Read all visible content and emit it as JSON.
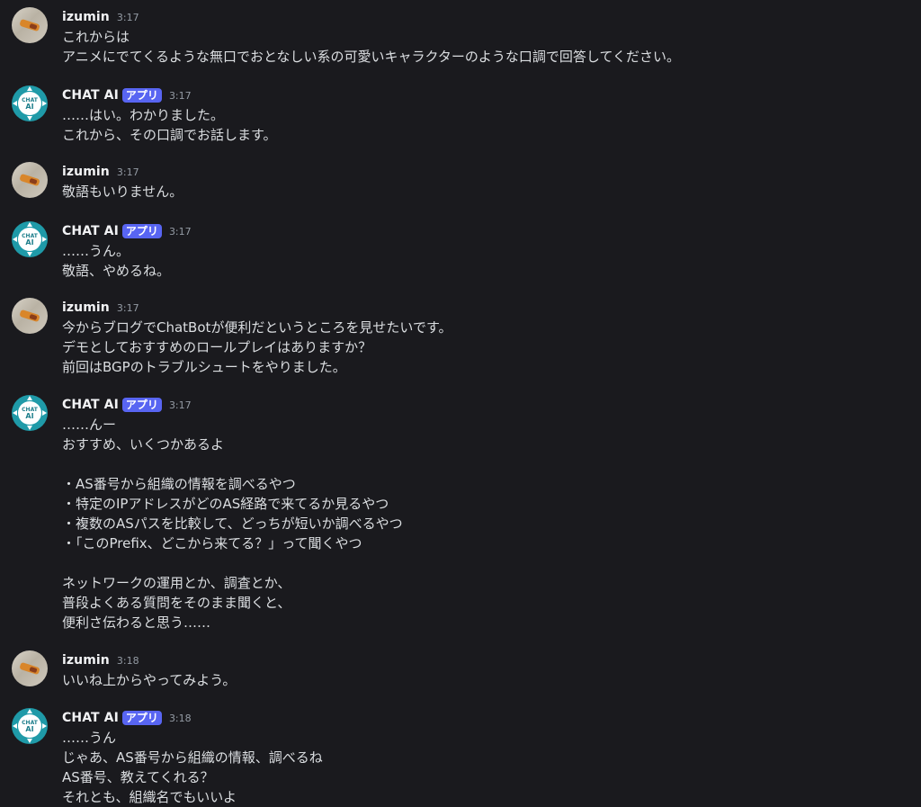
{
  "app_badge": "アプリ",
  "messages": [
    {
      "author": "izumin",
      "bot": false,
      "time": "3:17",
      "lines": [
        "これからは",
        "アニメにでてくるような無口でおとなしい系の可愛いキャラクターのような口調で回答してください。"
      ]
    },
    {
      "author": "CHAT AI",
      "bot": true,
      "time": "3:17",
      "lines": [
        "……はい。わかりました。",
        "これから、その口調でお話します。"
      ]
    },
    {
      "author": "izumin",
      "bot": false,
      "time": "3:17",
      "lines": [
        "敬語もいりません。"
      ]
    },
    {
      "author": "CHAT AI",
      "bot": true,
      "time": "3:17",
      "lines": [
        "……うん。",
        "敬語、やめるね。"
      ]
    },
    {
      "author": "izumin",
      "bot": false,
      "time": "3:17",
      "lines": [
        "今からブログでChatBotが便利だというところを見せたいです。",
        "デモとしておすすめのロールプレイはありますか？",
        "前回はBGPのトラブルシュートをやりました。"
      ]
    },
    {
      "author": "CHAT AI",
      "bot": true,
      "time": "3:17",
      "lines": [
        "……んー",
        "おすすめ、いくつかあるよ",
        "",
        "・AS番号から組織の情報を調べるやつ",
        "・特定のIPアドレスがどのAS経路で来てるか見るやつ",
        "・複数のASパスを比較して、どっちが短いか調べるやつ",
        "・「このPrefix、どこから来てる？」って聞くやつ",
        "",
        "ネットワークの運用とか、調査とか、",
        "普段よくある質問をそのまま聞くと、",
        "便利さ伝わると思う……"
      ]
    },
    {
      "author": "izumin",
      "bot": false,
      "time": "3:18",
      "lines": [
        "いいね上からやってみよう。"
      ]
    },
    {
      "author": "CHAT AI",
      "bot": true,
      "time": "3:18",
      "lines": [
        "……うん",
        "じゃあ、AS番号から組織の情報、調べるね",
        "AS番号、教えてくれる？",
        "それとも、組織名でもいいよ"
      ]
    }
  ],
  "bot_avatar_text": [
    "CHAT",
    "AI"
  ]
}
